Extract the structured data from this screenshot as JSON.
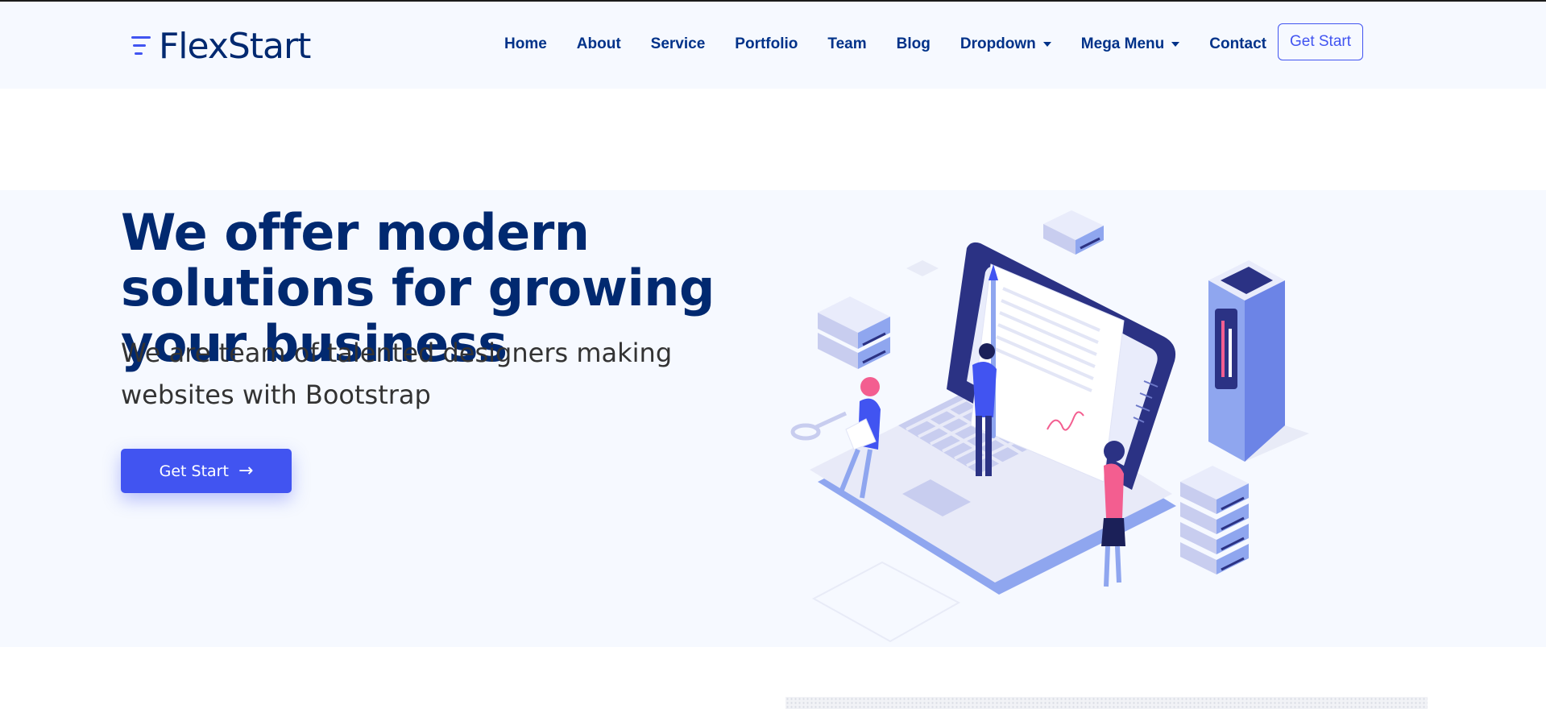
{
  "header": {
    "logo_text": "FlexStart",
    "nav": [
      {
        "label": "Home"
      },
      {
        "label": "About"
      },
      {
        "label": "Service"
      },
      {
        "label": "Portfolio"
      },
      {
        "label": "Team"
      },
      {
        "label": "Blog"
      },
      {
        "label": "Dropdown",
        "has_caret": true
      },
      {
        "label": "Mega Menu",
        "has_caret": true
      },
      {
        "label": "Contact"
      }
    ],
    "cta_label": "Get Start"
  },
  "hero": {
    "title": "We offer modern solutions for growing your business",
    "subtitle": "We are team of talented designers making websites with Bootstrap",
    "button_label": "Get Start",
    "button_icon": "arrow-right-icon"
  },
  "colors": {
    "brand_primary": "#4154f1",
    "brand_dark": "#012970",
    "hero_bg": "#f6f9ff"
  }
}
